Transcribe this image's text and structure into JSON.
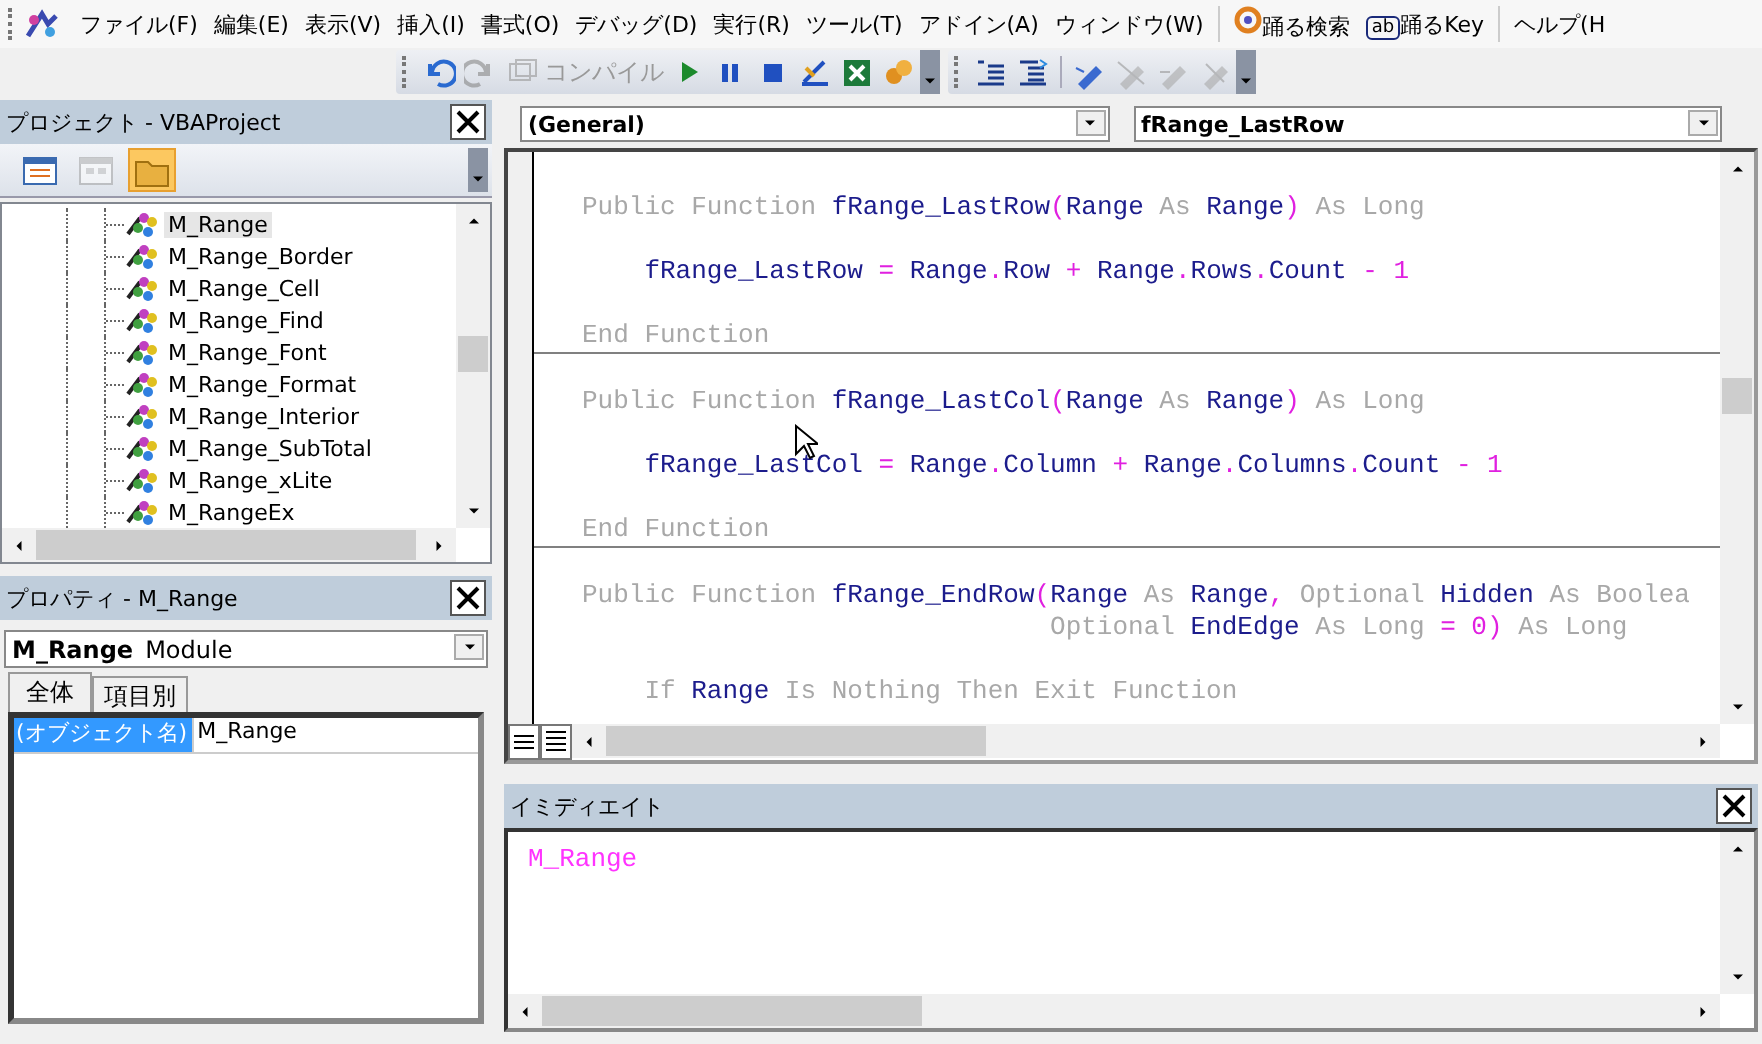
{
  "menu_bar": {
    "items": [
      {
        "label": "ファイル(F)",
        "kind": "menu"
      },
      {
        "label": "編集(E)",
        "kind": "menu"
      },
      {
        "label": "表示(V)",
        "kind": "menu"
      },
      {
        "label": "挿入(I)",
        "kind": "menu"
      },
      {
        "label": "書式(O)",
        "kind": "menu"
      },
      {
        "label": "デバッグ(D)",
        "kind": "menu"
      },
      {
        "label": "実行(R)",
        "kind": "menu"
      },
      {
        "label": "ツール(T)",
        "kind": "menu"
      },
      {
        "label": "アドイン(A)",
        "kind": "menu"
      },
      {
        "label": "ウィンドウ(W)",
        "kind": "menu"
      },
      {
        "label": "踊る検索",
        "kind": "addin"
      },
      {
        "label": "踊るKey",
        "kind": "addin",
        "icon_text": "ab"
      },
      {
        "label": "ヘルプ(H",
        "kind": "menu"
      }
    ]
  },
  "toolbars": [
    {
      "items": [
        {
          "disabled": false
        },
        {
          "disabled": true
        },
        {
          "disabled": true,
          "label": "コンパイル"
        },
        {
          "disabled": false
        },
        {
          "disabled": false
        },
        {
          "disabled": false
        },
        {
          "disabled": false
        },
        {
          "disabled": false
        },
        {
          "disabled": false
        }
      ]
    },
    {
      "items": [
        {
          "disabled": false
        },
        {
          "disabled": false
        },
        {
          "disabled": false
        },
        {
          "disabled": true
        },
        {
          "disabled": true
        },
        {
          "disabled": true
        }
      ]
    }
  ],
  "project_pane": {
    "title": "プロジェクト - VBAProject",
    "toolbar_buttons": [
      {
        "selected": false,
        "disabled": false
      },
      {
        "selected": false,
        "disabled": true
      },
      {
        "selected": true,
        "disabled": false
      }
    ],
    "tree": [
      {
        "label": "M_Range",
        "selected": true
      },
      {
        "label": "M_Range_Border",
        "selected": false
      },
      {
        "label": "M_Range_Cell",
        "selected": false
      },
      {
        "label": "M_Range_Find",
        "selected": false
      },
      {
        "label": "M_Range_Font",
        "selected": false
      },
      {
        "label": "M_Range_Format",
        "selected": false
      },
      {
        "label": "M_Range_Interior",
        "selected": false
      },
      {
        "label": "M_Range_SubTotal",
        "selected": false
      },
      {
        "label": "M_Range_xLite",
        "selected": false
      },
      {
        "label": "M_RangeEx",
        "selected": false
      }
    ]
  },
  "properties_pane": {
    "title": "プロパティ - M_Range",
    "object_name": "M_Range",
    "object_type": "Module",
    "tabs": [
      {
        "label": "全体",
        "selected": true
      },
      {
        "label": "項目別",
        "selected": false
      }
    ],
    "rows": [
      {
        "name": "(オブジェクト名)",
        "value": "M_Range",
        "selected": true
      }
    ]
  },
  "code_window": {
    "object_dropdown": "(General)",
    "procedure_dropdown": "fRange_LastRow",
    "procedures": [
      {
        "lines": [
          {
            "kind": "blank"
          },
          {
            "kind": "declaration",
            "tokens": [
              {
                "text": "Public Function ",
                "kind": "keyword"
              },
              {
                "text": "fRange_LastRow",
                "kind": "identifier"
              },
              {
                "text": "(",
                "kind": "operator"
              },
              {
                "text": "Range",
                "kind": "identifier"
              },
              {
                "text": " As ",
                "kind": "keyword"
              },
              {
                "text": "Range",
                "kind": "identifier"
              },
              {
                "text": ")",
                "kind": "operator"
              },
              {
                "text": " As Long",
                "kind": "keyword"
              }
            ]
          },
          {
            "kind": "blank"
          },
          {
            "kind": "body",
            "tokens": [
              {
                "text": "fRange_LastRow",
                "kind": "identifier"
              },
              {
                "text": " = ",
                "kind": "operator"
              },
              {
                "text": "Range",
                "kind": "identifier"
              },
              {
                "text": ".",
                "kind": "operator"
              },
              {
                "text": "Row",
                "kind": "identifier"
              },
              {
                "text": " + ",
                "kind": "operator"
              },
              {
                "text": "Range",
                "kind": "identifier"
              },
              {
                "text": ".",
                "kind": "operator"
              },
              {
                "text": "Rows",
                "kind": "identifier"
              },
              {
                "text": ".",
                "kind": "operator"
              },
              {
                "text": "Count",
                "kind": "identifier"
              },
              {
                "text": " - 1",
                "kind": "operator"
              }
            ]
          },
          {
            "kind": "blank"
          },
          {
            "kind": "declaration",
            "tokens": [
              {
                "text": "End Function",
                "kind": "keyword"
              }
            ]
          }
        ]
      },
      {
        "lines": [
          {
            "kind": "blank"
          },
          {
            "kind": "declaration",
            "tokens": [
              {
                "text": "Public Function ",
                "kind": "keyword"
              },
              {
                "text": "fRange_LastCol",
                "kind": "identifier"
              },
              {
                "text": "(",
                "kind": "operator"
              },
              {
                "text": "Range",
                "kind": "identifier"
              },
              {
                "text": " As ",
                "kind": "keyword"
              },
              {
                "text": "Range",
                "kind": "identifier"
              },
              {
                "text": ")",
                "kind": "operator"
              },
              {
                "text": " As Long",
                "kind": "keyword"
              }
            ]
          },
          {
            "kind": "blank"
          },
          {
            "kind": "body",
            "tokens": [
              {
                "text": "fRange_LastCol",
                "kind": "identifier"
              },
              {
                "text": " = ",
                "kind": "operator"
              },
              {
                "text": "Range",
                "kind": "identifier"
              },
              {
                "text": ".",
                "kind": "operator"
              },
              {
                "text": "Column",
                "kind": "identifier"
              },
              {
                "text": " + ",
                "kind": "operator"
              },
              {
                "text": "Range",
                "kind": "identifier"
              },
              {
                "text": ".",
                "kind": "operator"
              },
              {
                "text": "Columns",
                "kind": "identifier"
              },
              {
                "text": ".",
                "kind": "operator"
              },
              {
                "text": "Count",
                "kind": "identifier"
              },
              {
                "text": " - 1",
                "kind": "operator"
              }
            ]
          },
          {
            "kind": "blank"
          },
          {
            "kind": "declaration",
            "tokens": [
              {
                "text": "End Function",
                "kind": "keyword"
              }
            ]
          }
        ]
      },
      {
        "lines": [
          {
            "kind": "blank"
          },
          {
            "kind": "declaration",
            "tokens": [
              {
                "text": "Public Function ",
                "kind": "keyword"
              },
              {
                "text": "fRange_EndRow",
                "kind": "identifier"
              },
              {
                "text": "(",
                "kind": "operator"
              },
              {
                "text": "Range",
                "kind": "identifier"
              },
              {
                "text": " As ",
                "kind": "keyword"
              },
              {
                "text": "Range",
                "kind": "identifier"
              },
              {
                "text": ", ",
                "kind": "operator"
              },
              {
                "text": "Optional ",
                "kind": "keyword"
              },
              {
                "text": "Hidden",
                "kind": "identifier"
              },
              {
                "text": " As Boolea",
                "kind": "keyword"
              }
            ]
          },
          {
            "kind": "continuation",
            "tokens": [
              {
                "text": "Optional ",
                "kind": "keyword"
              },
              {
                "text": "EndEdge",
                "kind": "identifier"
              },
              {
                "text": " As Long ",
                "kind": "keyword"
              },
              {
                "text": "= 0)",
                "kind": "operator"
              },
              {
                "text": " As Long",
                "kind": "keyword"
              }
            ]
          },
          {
            "kind": "blank"
          },
          {
            "kind": "body",
            "tokens": [
              {
                "text": "If ",
                "kind": "keyword"
              },
              {
                "text": "Range",
                "kind": "identifier"
              },
              {
                "text": " Is Nothing Then Exit Function",
                "kind": "keyword"
              }
            ]
          }
        ]
      }
    ]
  },
  "immediate_pane": {
    "title": "イミディエイト",
    "output": "M_Range"
  }
}
